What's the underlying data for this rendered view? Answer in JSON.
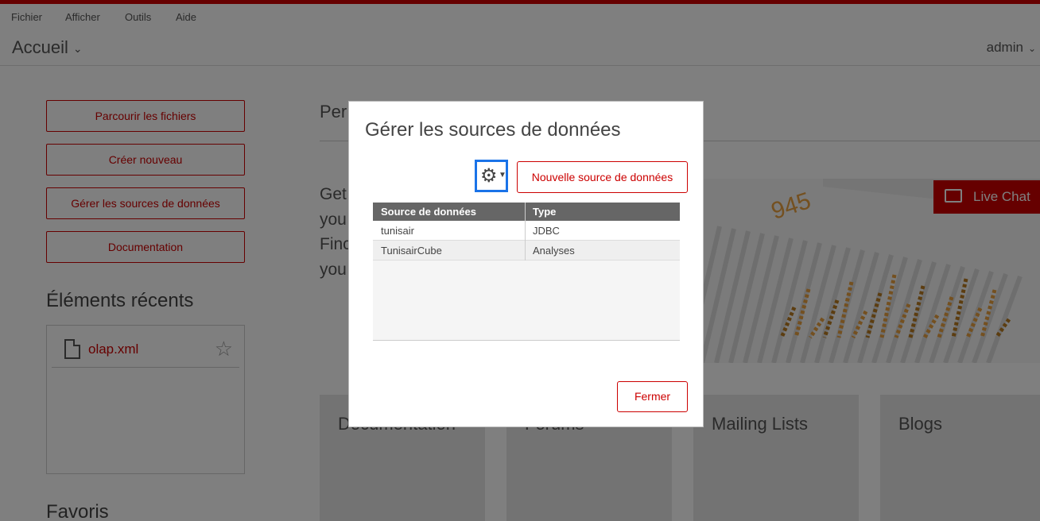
{
  "menu": [
    "Fichier",
    "Afficher",
    "Outils",
    "Aide"
  ],
  "header": {
    "title": "Accueil",
    "user": "admin"
  },
  "sidebar": {
    "buttons": [
      "Parcourir les fichiers",
      "Créer nouveau",
      "Gérer les sources de données",
      "Documentation"
    ],
    "recent_title": "Éléments récents",
    "recent_items": [
      {
        "name": "olap.xml"
      }
    ],
    "favorites_title": "Favoris"
  },
  "main": {
    "heading": "Per",
    "intro_lines": [
      "Get",
      "you",
      "Finc",
      "you"
    ],
    "hero_number": "945",
    "live_chat": "Live Chat",
    "cards": [
      "Documentation",
      "Forums",
      "Mailing Lists",
      "Blogs"
    ]
  },
  "modal": {
    "title": "Gérer les sources de données",
    "new_button": "Nouvelle source de données",
    "columns": [
      "Source de données",
      "Type"
    ],
    "rows": [
      {
        "name": "tunisair",
        "type": "JDBC"
      },
      {
        "name": "TunisairCube",
        "type": "Analyses"
      }
    ],
    "close_button": "Fermer"
  }
}
